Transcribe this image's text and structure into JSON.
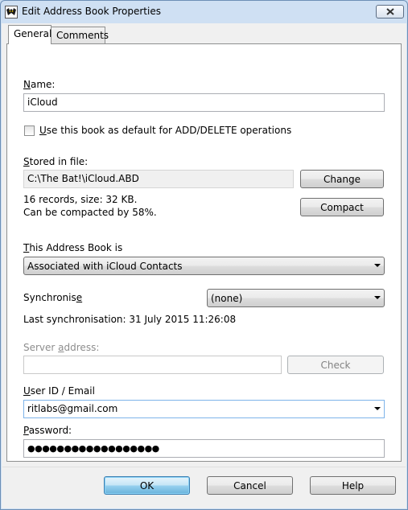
{
  "window": {
    "title": "Edit Address Book Properties"
  },
  "tabs": [
    {
      "label": "General",
      "active": true
    },
    {
      "label": "Comments",
      "active": false
    }
  ],
  "name": {
    "label_mnemonic": "N",
    "label_rest": "ame:",
    "value": "iCloud"
  },
  "default_checkbox": {
    "checked": false,
    "label_mnemonic": "U",
    "label_rest": "se this book as default for ADD/DELETE operations"
  },
  "stored": {
    "label_mnemonic": "S",
    "label_rest": "tored in file:",
    "path": "C:\\The Bat!\\iCloud.ABD",
    "change_label": "Change",
    "info_line1": "16 records, size: 32 KB.",
    "info_line2": "Can be compacted by 58%.",
    "compact_label": "Compact"
  },
  "book_type": {
    "label_mnemonic": "T",
    "label_rest": "his Address Book is",
    "selected": "Associated with iCloud Contacts"
  },
  "sync": {
    "label_prefix": "Synchronis",
    "label_mnemonic": "e",
    "selected": "(none)",
    "last": "Last synchronisation: 31 July 2015  11:26:08"
  },
  "server": {
    "label_prefix": "Server ",
    "label_mnemonic": "a",
    "label_rest": "ddress:",
    "value": "",
    "check_label": "Check"
  },
  "user": {
    "label_mnemonic": "U",
    "label_rest": "ser ID / Email",
    "value": "ritlabs@gmail.com"
  },
  "password": {
    "label_mnemonic": "P",
    "label_rest": "assword:",
    "masked": "●●●●●●●●●●●●●●●●●●"
  },
  "buttons": {
    "ok": "OK",
    "cancel": "Cancel",
    "help": "Help"
  },
  "colors": {
    "frame": "#cfe0f3",
    "client": "#f0f0f0",
    "panel": "#ffffff",
    "default_button": "#98d1ef"
  }
}
